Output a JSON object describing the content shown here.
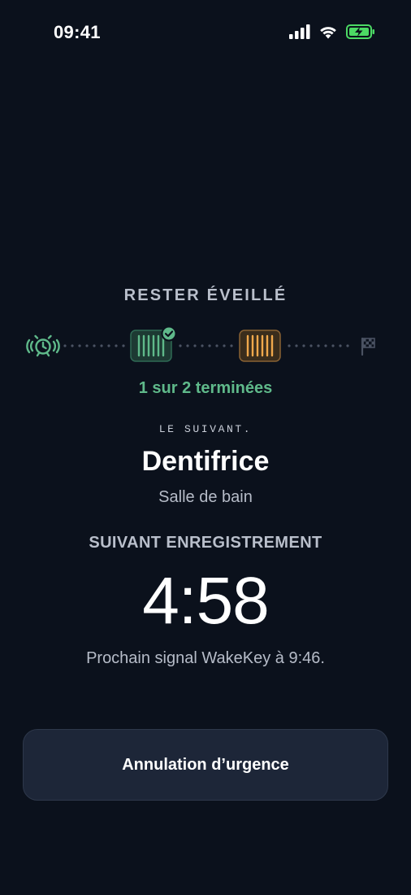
{
  "status_bar": {
    "time": "09:41",
    "icons": [
      "cellular-signal-icon",
      "wifi-icon",
      "battery-charging-icon"
    ],
    "battery_color": "#4cd964"
  },
  "routine": {
    "title": "RESTER ÉVEILLÉ",
    "steps": [
      {
        "icon": "alarm-clock-icon",
        "state": "start"
      },
      {
        "icon": "barcode-icon",
        "state": "completed"
      },
      {
        "icon": "barcode-icon",
        "state": "current"
      },
      {
        "icon": "checkered-flag-icon",
        "state": "finish"
      }
    ],
    "progress_text": "1 sur 2 terminées",
    "colors": {
      "completed": "#5fb98a",
      "current": "#f0a84c",
      "finish": "#4a5262",
      "dots": "#4a5262"
    }
  },
  "next": {
    "label": "LE SUIVANT.",
    "name": "Dentifrice",
    "room": "Salle de bain"
  },
  "timer": {
    "label": "SUIVANT ENREGISTREMENT",
    "value": "4:58",
    "signal_text": "Prochain signal WakeKey à 9:46."
  },
  "actions": {
    "emergency_label": "Annulation d’urgence"
  }
}
